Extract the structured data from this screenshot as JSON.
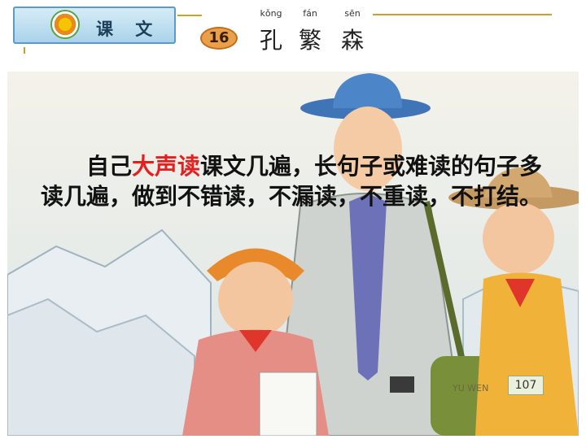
{
  "header": {
    "tab_label": "课 文",
    "lesson_number": "16",
    "title_pinyin": [
      "kǒng",
      "fán",
      "sēn"
    ],
    "title_chars": [
      "孔",
      "繁",
      "森"
    ]
  },
  "passage": {
    "part1": "自己",
    "highlight": "大声读",
    "part2": "课文几遍，长句子或难读的句子多读几遍，做到不错读，不漏读，不重读，不打结。"
  },
  "footer": {
    "caption": "YU WEN",
    "page_number": "107"
  },
  "colors": {
    "highlight": "#e61e1e",
    "accent_line": "#c9a227",
    "tab_blue": "#aad3ea"
  }
}
